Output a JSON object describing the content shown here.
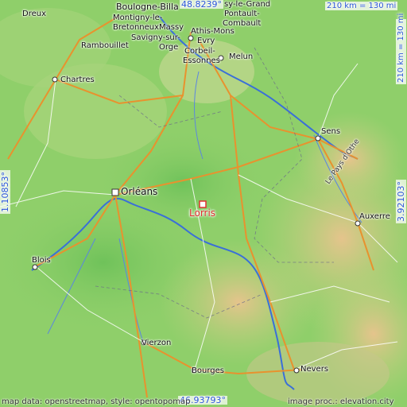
{
  "map": {
    "marker_label": "Lorris",
    "lat_top": "48.8239°",
    "lat_bottom": "46.93793°",
    "lon_left": "1.10853°",
    "lon_right": "3.92103°",
    "scale": "210 km = 130 mi",
    "credit_left": "map data: openstreetmap, style: opentopomap",
    "credit_right": "image proc.: elevation.city",
    "colors": {
      "lowland": "#8fcf6a",
      "hill": "#d9b97a",
      "river": "#3a6fd8",
      "road": "#e8922e",
      "marker": "#e03030"
    }
  },
  "places": [
    {
      "id": "dreux",
      "label": "Dreux"
    },
    {
      "id": "boulogne",
      "label": "Boulogne-Billa"
    },
    {
      "id": "montigny",
      "label": "Montigny-le-"
    },
    {
      "id": "bretonneux",
      "label": "Bretonneux"
    },
    {
      "id": "massy",
      "label": "Massy"
    },
    {
      "id": "savigny",
      "label": "Savigny-sur-"
    },
    {
      "id": "orge",
      "label": "Orge"
    },
    {
      "id": "athis",
      "label": "Athis-Mons"
    },
    {
      "id": "evry",
      "label": "Evry"
    },
    {
      "id": "corbeil",
      "label": "Corbeil-"
    },
    {
      "id": "essonnes",
      "label": "Essonnes"
    },
    {
      "id": "melun",
      "label": "Melun"
    },
    {
      "id": "pontault",
      "label": "Pontault-"
    },
    {
      "id": "combault",
      "label": "Combault"
    },
    {
      "id": "legrand",
      "label": "sy-le-Grand"
    },
    {
      "id": "rambouillet",
      "label": "Rambouillet"
    },
    {
      "id": "chartres",
      "label": "Chartres"
    },
    {
      "id": "sens",
      "label": "Sens"
    },
    {
      "id": "orleans",
      "label": "Orléans"
    },
    {
      "id": "auxerre",
      "label": "Auxerre"
    },
    {
      "id": "blois",
      "label": "Blois"
    },
    {
      "id": "vierzon",
      "label": "Vierzon"
    },
    {
      "id": "bourges",
      "label": "Bourges"
    },
    {
      "id": "nevers",
      "label": "Nevers"
    },
    {
      "id": "paysdothe",
      "label": "Le Pays d'Othe"
    }
  ]
}
